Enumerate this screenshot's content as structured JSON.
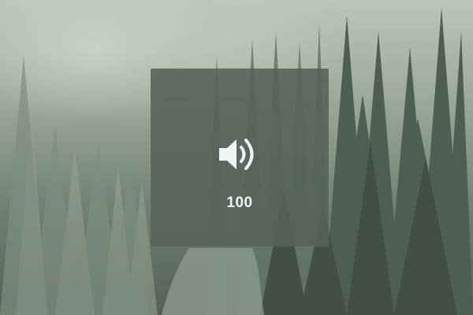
{
  "wallpaper": {
    "description_icon": "misty-forest-wallpaper"
  },
  "volume_hud": {
    "icon": "speaker-volume-icon",
    "level": 100,
    "level_label": "100",
    "text_color": "#f2f4f2",
    "panel_color": "#54625a"
  }
}
